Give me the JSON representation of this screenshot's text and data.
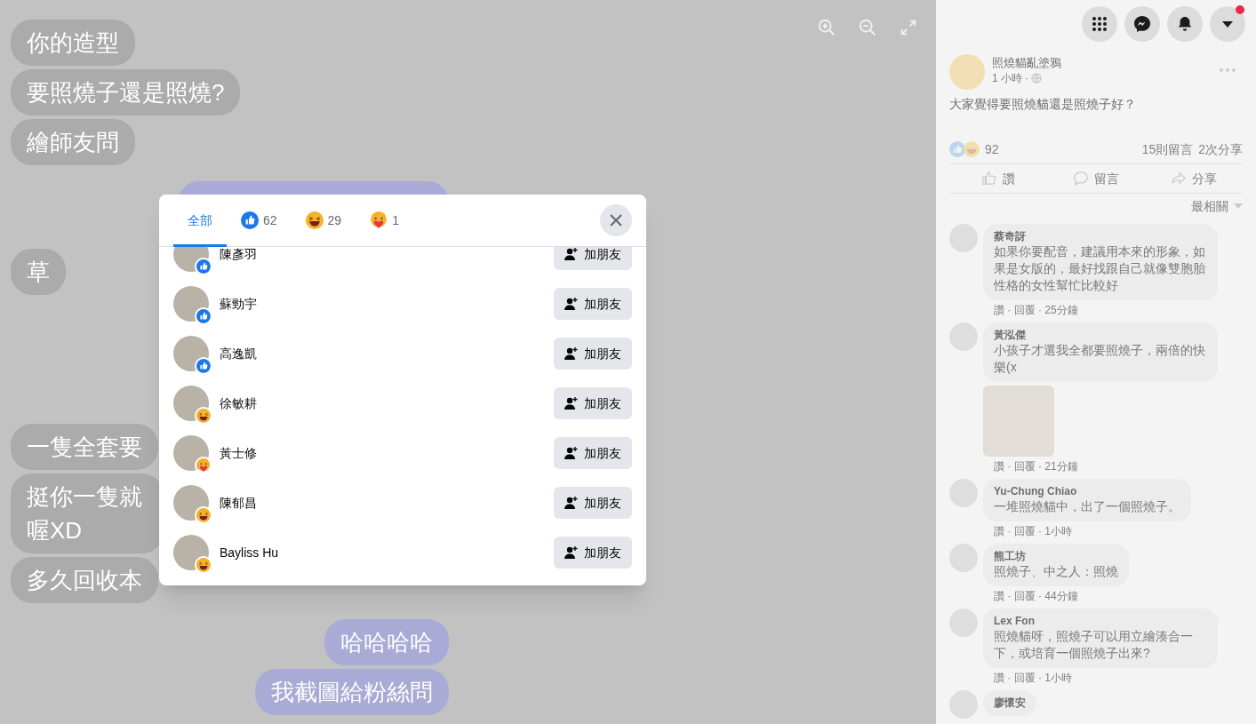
{
  "viewer": {
    "message_groups": [
      {
        "kind": "received",
        "messages": [
          "你的造型",
          "要照燒子還是照燒?",
          "繪師友問"
        ]
      },
      {
        "kind": "covered"
      },
      {
        "kind": "received",
        "messages": [
          "草"
        ]
      },
      {
        "kind": "covered"
      },
      {
        "kind": "received",
        "messages": [
          "一隻全套要",
          "挺你一隻就喔XD",
          "多久回收本"
        ]
      },
      {
        "kind": "sent",
        "messages": [
          "哈哈哈哈",
          "我截圖給粉絲問"
        ]
      }
    ]
  },
  "reactions_dialog": {
    "tabs": [
      {
        "label": "全部",
        "kind": "all",
        "selected": true
      },
      {
        "label": "62",
        "kind": "like",
        "selected": false
      },
      {
        "label": "29",
        "kind": "haha",
        "selected": false
      },
      {
        "label": "1",
        "kind": "care",
        "selected": false
      }
    ],
    "people": [
      {
        "name": "陳彥羽",
        "kind": "like",
        "button": "加朋友"
      },
      {
        "name": "蘇勁宇",
        "kind": "like",
        "button": "加朋友"
      },
      {
        "name": "高逸凱",
        "kind": "like",
        "button": "加朋友"
      },
      {
        "name": "徐敏耕",
        "kind": "haha",
        "button": "加朋友"
      },
      {
        "name": "黃士修",
        "kind": "care",
        "button": "加朋友"
      },
      {
        "name": "陳郁昌",
        "kind": "haha",
        "button": "加朋友"
      },
      {
        "name": "Bayliss Hu",
        "kind": "haha",
        "button": "加朋友"
      }
    ]
  },
  "post": {
    "author": "照燒貓亂塗鴉",
    "time": "1 小時 ·",
    "text": "大家覺得要照燒貓還是照燒子好？",
    "reaction_count": "92",
    "comments_count": "15則留言",
    "shares_count": "2次分享",
    "actions": [
      {
        "label": "讚",
        "kind": "like"
      },
      {
        "label": "留言",
        "kind": "comment"
      },
      {
        "label": "分享",
        "kind": "share"
      }
    ],
    "sort": "最相關",
    "comments": [
      {
        "name": "蔡奇訝",
        "text": "如果你要配音，建議用本來的形象，如果是女版的，最好找跟自己就像雙胞胎性格的女性幫忙比較好",
        "meta": "讚 · 回覆 · 25分鐘",
        "kind": "text"
      },
      {
        "name": "黃泓傑",
        "text": "小孩子才選我全都要照燒子，兩倍的快樂(x",
        "meta": "讚 · 回覆 · 21分鐘",
        "kind": "sticker"
      },
      {
        "name": "Yu-Chung Chiao",
        "text": "一堆照燒貓中，出了一個照燒子。",
        "meta": "讚 · 回覆 · 1小時",
        "kind": "text"
      },
      {
        "name": "熊工坊",
        "text": "照燒子、中之人：照燒",
        "meta": "讚 · 回覆 · 44分鐘",
        "kind": "text"
      },
      {
        "name": "Lex Fon",
        "text": "照燒貓呀，照燒子可以用立繪湊合一下，或培育一個照燒子出來?",
        "meta": "讚 · 回覆 · 1小時",
        "kind": "text"
      },
      {
        "name": "廖懷安",
        "kind": "text"
      }
    ]
  }
}
